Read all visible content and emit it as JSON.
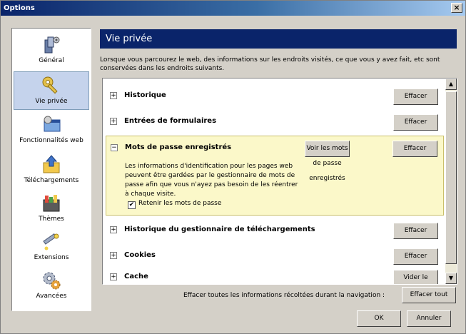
{
  "window": {
    "title": "Options",
    "close_label": "×"
  },
  "sidebar": {
    "items": [
      {
        "label": "Général",
        "icon": "general-icon",
        "selected": false
      },
      {
        "label": "Vie privée",
        "icon": "privacy-icon",
        "selected": true
      },
      {
        "label": "Fonctionnalités web",
        "icon": "web-features-icon",
        "selected": false
      },
      {
        "label": "Téléchargements",
        "icon": "downloads-icon",
        "selected": false
      },
      {
        "label": "Thèmes",
        "icon": "themes-icon",
        "selected": false
      },
      {
        "label": "Extensions",
        "icon": "extensions-icon",
        "selected": false
      },
      {
        "label": "Avancées",
        "icon": "advanced-icon",
        "selected": false
      }
    ]
  },
  "panel": {
    "title": "Vie privée",
    "description": "Lorsque vous parcourez le web, des informations sur les endroits visités, ce que vous y avez fait, etc sont conservées dans les endroits suivants."
  },
  "list": {
    "items": [
      {
        "label": "Historique",
        "button": "Effacer",
        "expander": "+"
      },
      {
        "label": "Entrées de formulaires",
        "button": "Effacer",
        "expander": "+"
      },
      {
        "label": "Mots de passe enregistrés",
        "button": "Effacer",
        "expander": "−",
        "details": "Les informations d'identification pour les pages web peuvent être gardées par le gestionnaire de mots de passe afin que vous n'ayez pas besoin de les réentrer à chaque visite.",
        "view_button": "Voir les mots de passe enregistrés",
        "checkbox_label": "Retenir les mots de passe",
        "checkbox_checked": true,
        "checkbox_mark": "✔"
      },
      {
        "label": "Historique du gestionnaire de téléchargements",
        "button": "Effacer",
        "expander": "+"
      },
      {
        "label": "Cookies",
        "button": "Effacer",
        "expander": "+"
      },
      {
        "label": "Cache",
        "button": "Vider le cache",
        "expander": "+"
      }
    ]
  },
  "scroll": {
    "up": "▲",
    "down": "▼"
  },
  "footer": {
    "clear_all_text": "Effacer toutes les informations récoltées durant la navigation :",
    "clear_all_button": "Effacer tout",
    "ok": "OK",
    "cancel": "Annuler"
  },
  "colors": {
    "header_bg": "#0a246a",
    "expanded_bg": "#fbf8c9",
    "window_bg": "#d4d0c8"
  }
}
